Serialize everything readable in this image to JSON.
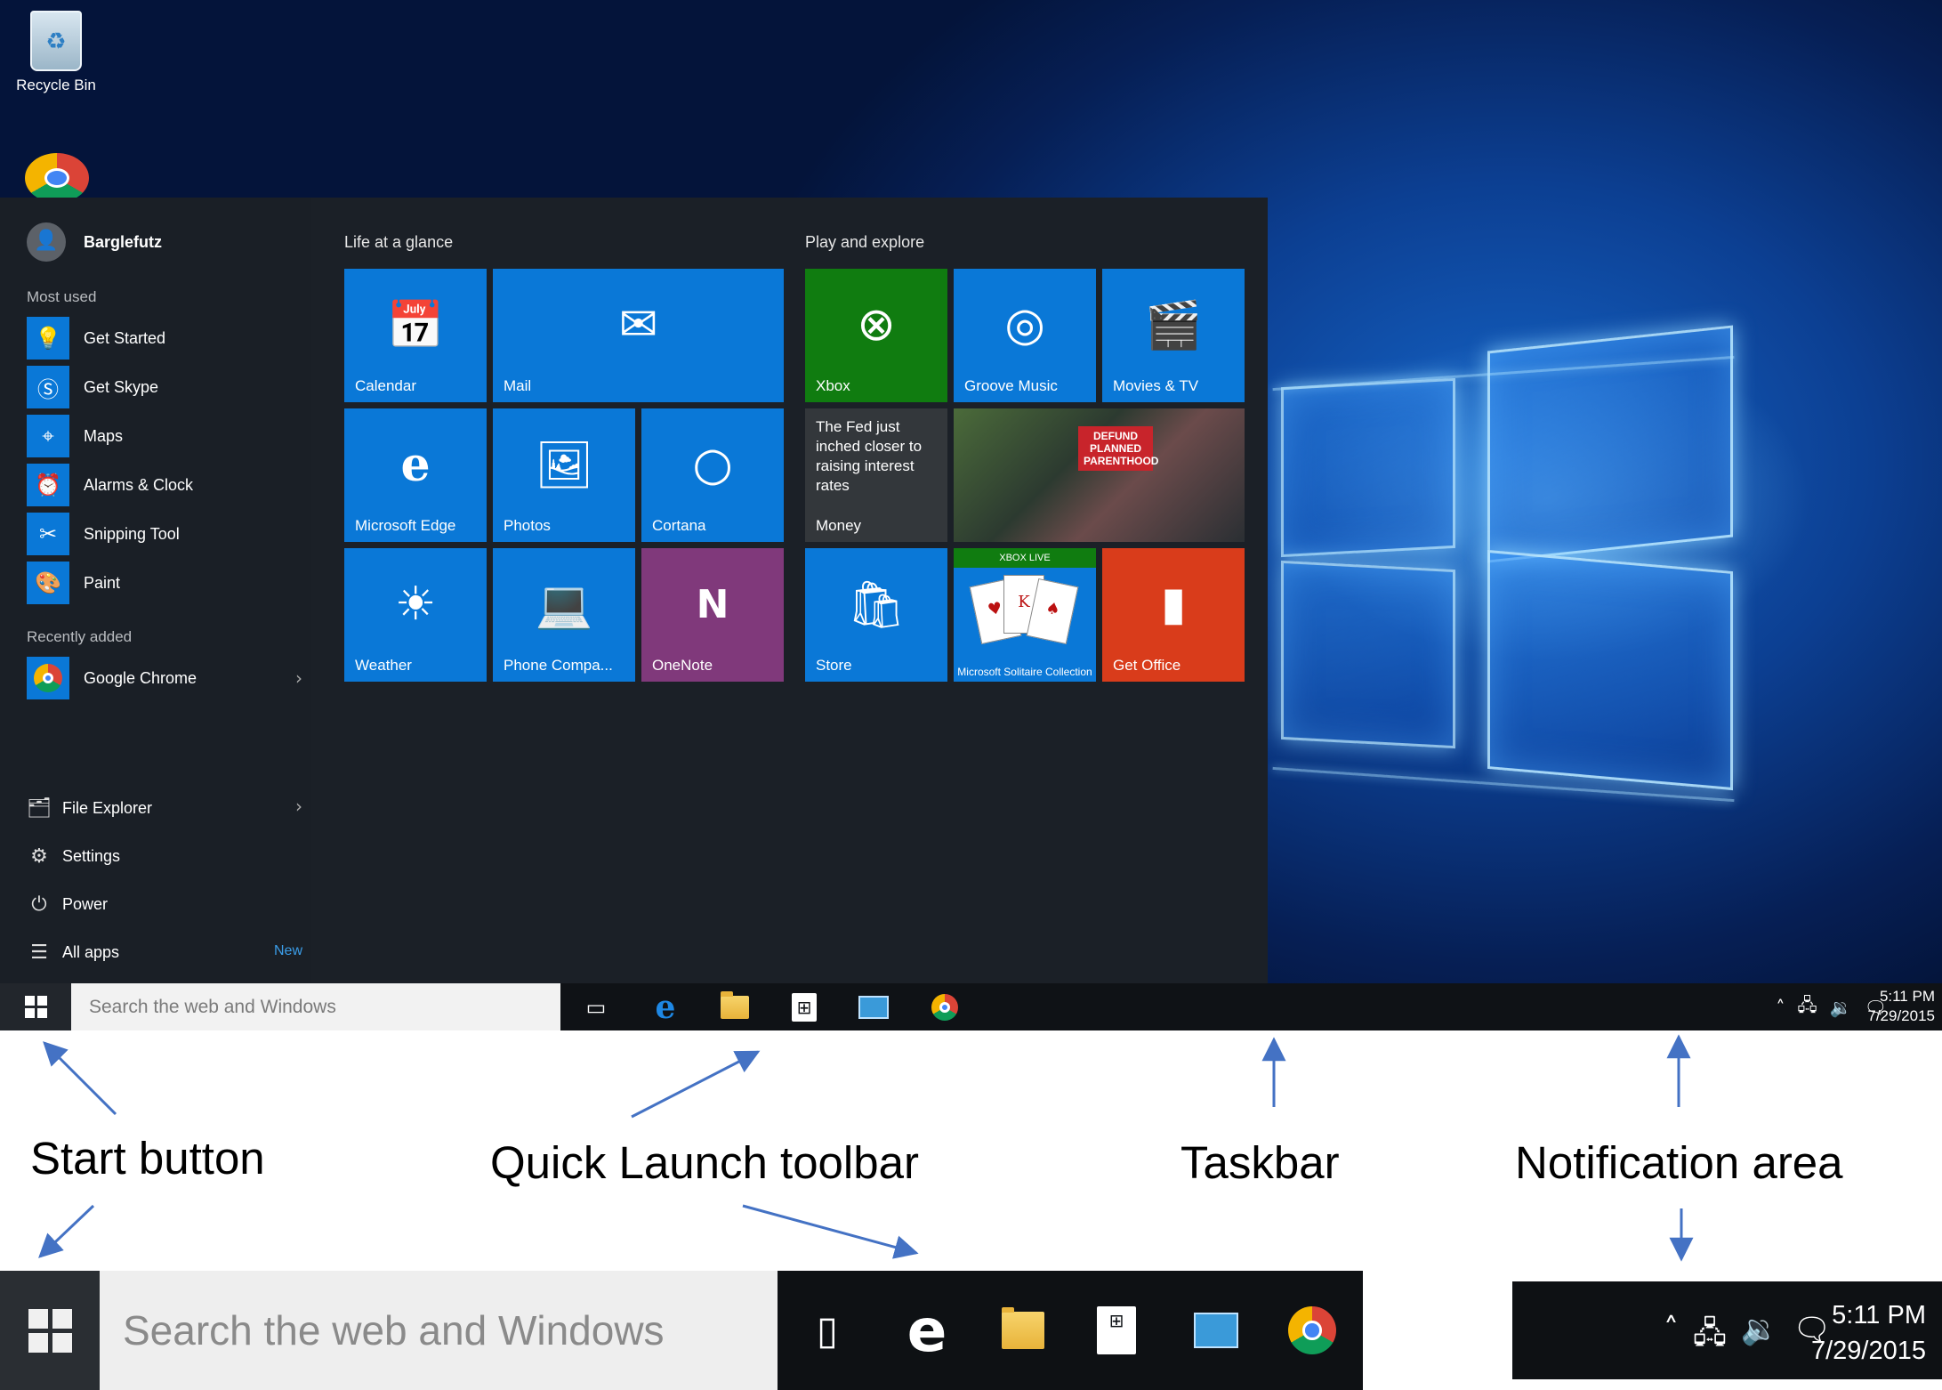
{
  "desktop": {
    "icons": [
      {
        "label": "Recycle Bin",
        "icon": "recycle-bin-icon"
      },
      {
        "label": "",
        "icon": "chrome-icon"
      }
    ]
  },
  "start_menu": {
    "user_name": "Barglefutz",
    "most_used_label": "Most used",
    "most_used": [
      {
        "label": "Get Started",
        "icon": "lightbulb-icon"
      },
      {
        "label": "Get Skype",
        "icon": "skype-icon"
      },
      {
        "label": "Maps",
        "icon": "maps-icon"
      },
      {
        "label": "Alarms & Clock",
        "icon": "alarm-clock-icon"
      },
      {
        "label": "Snipping Tool",
        "icon": "scissors-icon"
      },
      {
        "label": "Paint",
        "icon": "paint-palette-icon"
      }
    ],
    "recently_added_label": "Recently added",
    "recently_added": [
      {
        "label": "Google Chrome",
        "icon": "chrome-icon"
      }
    ],
    "system_items": [
      {
        "label": "File Explorer",
        "icon": "file-explorer-icon"
      },
      {
        "label": "Settings",
        "icon": "gear-icon"
      },
      {
        "label": "Power",
        "icon": "power-icon"
      },
      {
        "label": "All apps",
        "icon": "list-icon",
        "badge": "New"
      }
    ],
    "groups": {
      "life": {
        "title": "Life at a glance",
        "tiles": [
          {
            "label": "Calendar",
            "icon": "calendar-icon"
          },
          {
            "label": "Mail",
            "icon": "mail-icon"
          },
          {
            "label": "Microsoft Edge",
            "icon": "edge-icon"
          },
          {
            "label": "Photos",
            "icon": "photos-icon"
          },
          {
            "label": "Cortana",
            "icon": "cortana-icon"
          },
          {
            "label": "Weather",
            "icon": "sun-icon"
          },
          {
            "label": "Phone Compa...",
            "icon": "phone-companion-icon"
          },
          {
            "label": "OneNote",
            "icon": "onenote-icon"
          }
        ]
      },
      "play": {
        "title": "Play and explore",
        "tiles": [
          {
            "label": "Xbox",
            "icon": "xbox-icon"
          },
          {
            "label": "Groove Music",
            "icon": "groove-music-icon"
          },
          {
            "label": "Movies & TV",
            "icon": "clapperboard-icon"
          },
          {
            "label": "Money",
            "headline": "The Fed just inched closer to raising interest rates",
            "icon": "money-icon"
          },
          {
            "label": "",
            "icon": "news-photo",
            "sign": "DEFUND PLANNED PARENTHOOD"
          },
          {
            "label": "Store",
            "icon": "store-icon"
          },
          {
            "label": "Microsoft Solitaire Collection",
            "icon": "solitaire-cards-icon",
            "banner": "XBOX LIVE"
          },
          {
            "label": "Get Office",
            "icon": "office-icon"
          }
        ]
      }
    }
  },
  "taskbar": {
    "search_placeholder": "Search the web and Windows",
    "quick_launch": [
      "task-view-icon",
      "edge-icon",
      "file-explorer-icon",
      "store-icon",
      "outlook-icon",
      "chrome-icon"
    ],
    "tray_icons": [
      "chevron-up-icon",
      "network-icon",
      "volume-icon",
      "action-center-icon"
    ],
    "time": "5:11 PM",
    "date": "7/29/2015"
  },
  "annotations": {
    "start_button": "Start button",
    "quick_launch": "Quick Launch toolbar",
    "taskbar": "Taskbar",
    "notification_area": "Notification area"
  },
  "colors": {
    "accent": "#0a78d7",
    "xbox_green": "#107c10",
    "onenote_purple": "#80397b",
    "office_orange": "#d93c1b",
    "menu_background": "#1b2027",
    "arrow": "#4472c4"
  }
}
